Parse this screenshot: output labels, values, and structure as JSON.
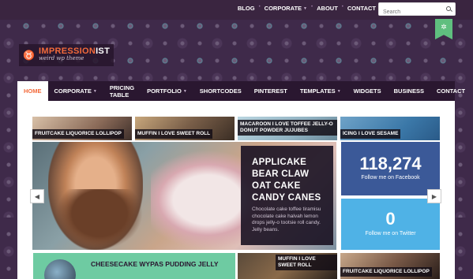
{
  "top_nav": [
    {
      "label": "BLOG",
      "has_chevron": false
    },
    {
      "label": "CORPORATE",
      "has_chevron": true
    },
    {
      "label": "ABOUT",
      "has_chevron": false
    },
    {
      "label": "CONTACT",
      "has_chevron": false
    }
  ],
  "search": {
    "placeholder": "Search",
    "icon": "magnifier"
  },
  "ribbon": {
    "icon": "gear",
    "glyph": "✲",
    "color": "#5fbf7f"
  },
  "logo": {
    "name_part1": "IMPRESSION",
    "name_part2": "IST",
    "tagline": "weird wp theme",
    "icon": "bull",
    "glyph": "♉",
    "accent": "#f36a3b"
  },
  "main_nav": [
    {
      "label": "HOME",
      "active": true,
      "has_chevron": false
    },
    {
      "label": "CORPORATE",
      "active": false,
      "has_chevron": true
    },
    {
      "label": "PRICING TABLE",
      "active": false,
      "has_chevron": false
    },
    {
      "label": "PORTFOLIO",
      "active": false,
      "has_chevron": true
    },
    {
      "label": "SHORTCODES",
      "active": false,
      "has_chevron": false
    },
    {
      "label": "PINTEREST",
      "active": false,
      "has_chevron": false
    },
    {
      "label": "TEMPLATES",
      "active": false,
      "has_chevron": true
    },
    {
      "label": "WIDGETS",
      "active": false,
      "has_chevron": false
    },
    {
      "label": "BUSINESS",
      "active": false,
      "has_chevron": false
    },
    {
      "label": "CONTACT",
      "active": false,
      "has_chevron": false
    }
  ],
  "thumbnails": [
    {
      "caption": "FRUITCAKE LIQUORICE LOLLIPOP"
    },
    {
      "caption": "MUFFIN I LOVE SWEET ROLL"
    },
    {
      "caption": "MACAROON I LOVE TOFFEE JELLY-O DONUT POWDER JUJUBES"
    },
    {
      "caption": "ICING I LOVE SESAME"
    }
  ],
  "hero": {
    "title": "APPLICAKE BEAR CLAW OAT CAKE CANDY CANES",
    "description": "Chocolate cake toffee tiramisu chocolate cake halvah lemon drops jelly-o tootsie roll candy. Jelly beans."
  },
  "social": {
    "facebook": {
      "count": "118,274",
      "label": "Follow me on Facebook",
      "color": "#3b5998"
    },
    "twitter": {
      "count": "0",
      "label": "Follow me on Twitter",
      "color": "#4fb2e6"
    }
  },
  "arrows": {
    "prev_glyph": "◀",
    "next_glyph": "▶"
  },
  "bottom_cards": [
    {
      "title": "CHEESECAKE WYPAS PUDDING JELLY",
      "color": "#6ecba2"
    },
    {
      "caption": "MUFFIN I LOVE SWEET ROLL"
    },
    {
      "caption": "FRUITCAKE LIQUORICE LOLLIPOP"
    }
  ]
}
